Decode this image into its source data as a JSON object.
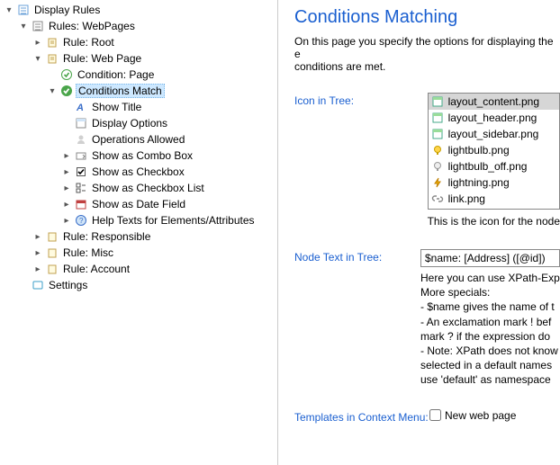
{
  "tree": {
    "root": "Display Rules",
    "webpages": "Rules: WebPages",
    "ruleRoot": "Rule: Root",
    "ruleWebPage": "Rule: Web Page",
    "conditionPage": "Condition: Page",
    "conditionsMatch": "Conditions Match",
    "showTitle": "Show Title",
    "displayOptions": "Display Options",
    "operationsAllowed": "Operations Allowed",
    "showCombo": "Show as Combo Box",
    "showCheckbox": "Show as Checkbox",
    "showCheckboxList": "Show as Checkbox List",
    "showDateField": "Show as Date Field",
    "helpTexts": "Help Texts for Elements/Attributes",
    "ruleResponsible": "Rule: Responsible",
    "ruleMisc": "Rule: Misc",
    "ruleAccount": "Rule: Account",
    "settings": "Settings"
  },
  "panel": {
    "title": "Conditions Matching",
    "description": "On this page you specify the options for displaying the e",
    "description2": "conditions are met.",
    "iconLabel": "Icon in Tree:",
    "iconHint": "This is the icon for the node",
    "nodeTextLabel": "Node Text in Tree:",
    "nodeTextValue": "$name: [Address] ([@id])",
    "notes": [
      "Here you can use XPath-Exp",
      "More specials:",
      "- $name gives the name of t",
      "- An exclamation mark ! bef",
      "   mark ? if the expression do",
      "- Note: XPath does not know",
      "   selected in a default names",
      "   use 'default' as namespace"
    ],
    "templatesLabel": "Templates in Context Menu:",
    "templateOption": "New web page"
  },
  "iconList": [
    {
      "name": "layout_content.png",
      "icon": "layout",
      "sel": true
    },
    {
      "name": "layout_header.png",
      "icon": "layout"
    },
    {
      "name": "layout_sidebar.png",
      "icon": "layout"
    },
    {
      "name": "lightbulb.png",
      "icon": "bulb"
    },
    {
      "name": "lightbulb_off.png",
      "icon": "bulb-off"
    },
    {
      "name": "lightning.png",
      "icon": "bolt"
    },
    {
      "name": "link.png",
      "icon": "link"
    }
  ]
}
